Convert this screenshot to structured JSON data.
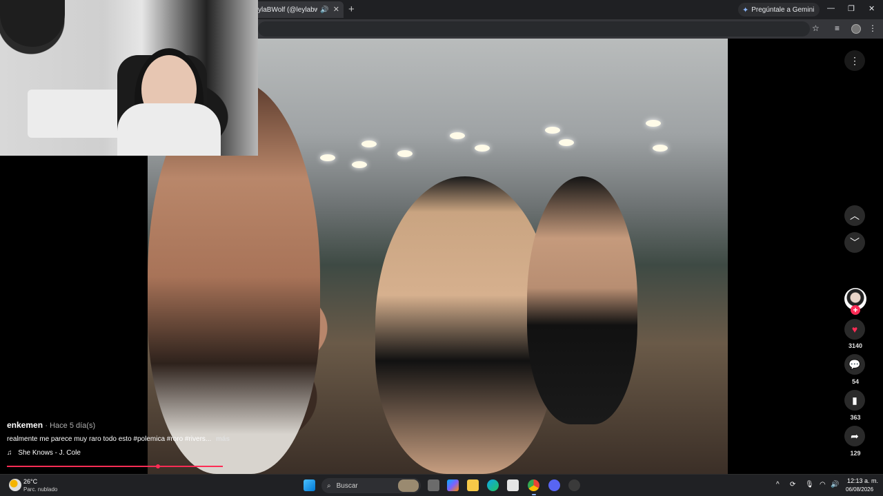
{
  "browser": {
    "tab_title": "ylaBWolf (@leylabwolf) |",
    "tab_audio_icon": "speaker-icon",
    "tab_close": "✕",
    "new_tab": "+",
    "gemini_label": "Pregúntale a Gemini",
    "window_controls": [
      "—",
      "❐",
      "✕"
    ]
  },
  "video": {
    "author": "enkemen",
    "posted": "· Hace 5 día(s)",
    "caption": "realmente me parece muy raro todo esto #polemica #roro #rivers...",
    "more_label": "más",
    "music_icon": "♫",
    "music": "She Knows - J. Cole",
    "progress_fraction": 0.7
  },
  "actions": {
    "more_options": "⋮",
    "prev": "︿",
    "next": "﹀",
    "follow": "+",
    "like_count": "3140",
    "comment_count": "54",
    "save_count": "363",
    "share_count": "129"
  },
  "taskbar": {
    "temperature": "26°C",
    "weather": "Parc. nublado",
    "search_placeholder": "Buscar",
    "time": "12:13 a. m.",
    "date": "06/08/2026"
  },
  "colors": {
    "accent": "#fe2c55",
    "background": "#000000",
    "chrome_dark": "#1f2023"
  }
}
